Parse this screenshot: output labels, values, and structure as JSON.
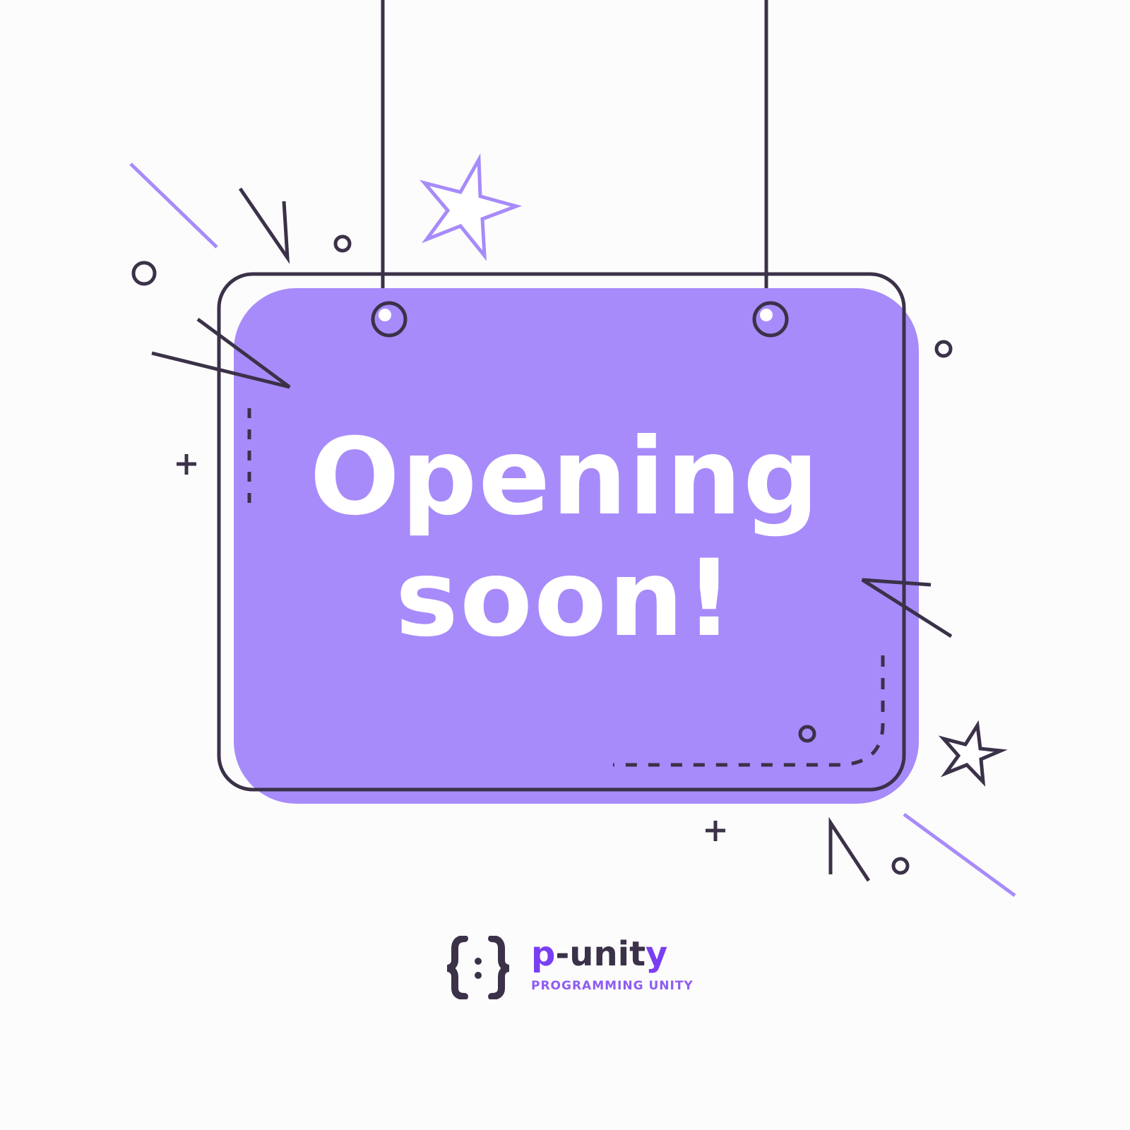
{
  "sign": {
    "line1": "Opening",
    "line2": "soon!"
  },
  "brand": {
    "name_p": "p",
    "name_dash": "-",
    "name_uni": "uni",
    "name_t": "t",
    "name_y": "y",
    "tagline": "PROGRAMMING UNITY",
    "logo_icon": "curly-braces-logo-icon"
  },
  "colors": {
    "background": "#fcfcfc",
    "sign_fill": "#a78bfa",
    "outline": "#3b3148",
    "accent": "#7b3ff2",
    "text": "#ffffff"
  }
}
